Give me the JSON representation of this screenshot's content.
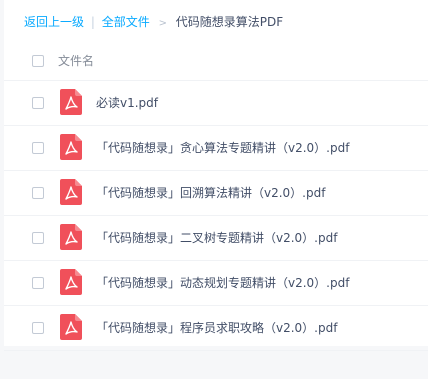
{
  "breadcrumb": {
    "back": "返回上一级",
    "separator": "|",
    "all_files": "全部文件",
    "arrow": ">",
    "current": "代码随想录算法PDF"
  },
  "header": {
    "name_column": "文件名"
  },
  "files": [
    {
      "name": "必读v1.pdf",
      "icon": "pdf-file-icon"
    },
    {
      "name": "「代码随想录」贪心算法专题精讲（v2.0）.pdf",
      "icon": "pdf-file-icon"
    },
    {
      "name": "「代码随想录」回溯算法精讲（v2.0）.pdf",
      "icon": "pdf-file-icon"
    },
    {
      "name": "「代码随想录」二叉树专题精讲（v2.0）.pdf",
      "icon": "pdf-file-icon"
    },
    {
      "name": "「代码随想录」动态规划专题精讲（v2.0）.pdf",
      "icon": "pdf-file-icon"
    },
    {
      "name": "「代码随想录」程序员求职攻略（v2.0）.pdf",
      "icon": "pdf-file-icon"
    }
  ],
  "colors": {
    "link": "#09aaff",
    "pdf_icon": "#f0505a",
    "text": "#424e67"
  }
}
